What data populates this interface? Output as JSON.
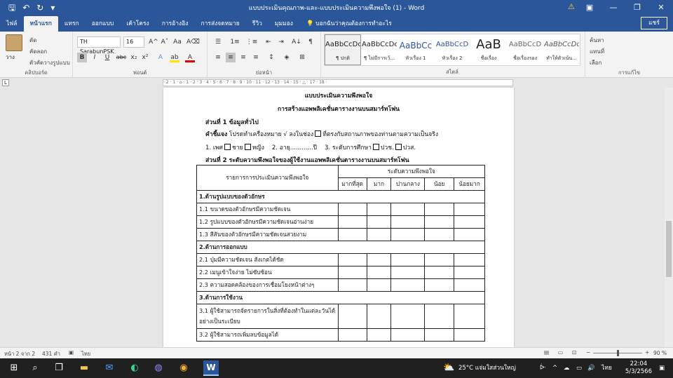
{
  "titlebar": {
    "title": "แบบประเมินคุณภาพ-และ-แบบประเมินความพึงพอใจ (1) - Word",
    "save_glyph": "🖫",
    "undo_glyph": "↶",
    "redo_glyph": "↻",
    "customize_glyph": "▾",
    "warning_glyph": "⚠",
    "ribbon_options_glyph": "▣",
    "minimize_glyph": "—",
    "restore_glyph": "❐",
    "close_glyph": "✕"
  },
  "tabs": [
    "ไฟล์",
    "หน้าแรก",
    "แทรก",
    "ออกแบบ",
    "เค้าโครง",
    "การอ้างอิง",
    "การส่งจดหมาย",
    "รีวิว",
    "มุมมอง"
  ],
  "tell_me": "💡 บอกฉันว่าคุณต้องการทำอะไร",
  "user_label": "แชร์",
  "ribbon": {
    "clipboard": {
      "paste": "วาง",
      "cut": "ตัด",
      "copy": "คัดลอก",
      "format_painter": "ตัวคัดวางรูปแบบ",
      "label": "คลิปบอร์ด"
    },
    "font": {
      "name": "TH SarabunPSK",
      "size": "16",
      "bold": "B",
      "italic": "I",
      "underline": "U",
      "strike": "abc",
      "subscript": "x₂",
      "superscript": "x²",
      "grow": "A^",
      "shrink": "Aˇ",
      "case": "Aa",
      "clear": "A⌫",
      "effects": "A",
      "highlight": "ab",
      "color": "A",
      "label": "ฟอนต์"
    },
    "paragraph": {
      "label": "ย่อหน้า",
      "bullets": "☰",
      "numbering": "1≡",
      "multilevel": "⋮≡",
      "decrease": "⇤",
      "increase": "⇥",
      "sort": "A↓",
      "marks": "¶",
      "align_left": "≡",
      "center": "≡",
      "align_right": "≡",
      "justify": "≡",
      "spacing": "↕",
      "shading": "◈",
      "borders": "⊞"
    },
    "styles": {
      "items": [
        {
          "sample": "AaBbCcDc",
          "name": "¶ ปกติ"
        },
        {
          "sample": "AaBbCcDc",
          "name": "¶ ไม่มีการเว้..."
        },
        {
          "sample": "AaBbCc",
          "name": "หัวเรื่อง 1"
        },
        {
          "sample": "AaBbCcD",
          "name": "หัวเรื่อง 2"
        },
        {
          "sample": "AaB",
          "name": "ชื่อเรื่อง"
        },
        {
          "sample": "AaBbCcD",
          "name": "ชื่อเรื่องรอง"
        },
        {
          "sample": "AaBbCcDc",
          "name": "ทำให้ตัวเน้น..."
        }
      ],
      "label": "สไตล์"
    },
    "editing": {
      "find": "ค้นหา",
      "replace": "แทนที่",
      "select": "เลือก",
      "label": "การแก้ไข"
    }
  },
  "ruler_text": "· 2 · 1 · ⌂ · 1 · 2 · 3 · 4 · 5 · 6 · 7 · 8 · 9 · 10 · 11 · 12 · 13 · 14 · 15 · △ · 17 · 18 ·",
  "ruler_tab_glyph": "L",
  "document": {
    "title1": "แบบประเมินความพึงพอใจ",
    "title2": "การสร้างแอพพลิเคชั่นตารางงานบนสมาร์ทโฟน",
    "part1": "ส่วนที่ 1 ข้อมูลทั่วไป",
    "instruction_label": "คำชี้แจง",
    "instruction_text": "โปรดทำเครื่องหมาย √ ลงในช่อง",
    "instruction_tail": "ที่ตรงกับสถานภาพของท่านตามความเป็นจริง",
    "q1": "1. เพศ",
    "q1_opt1": "ชาย",
    "q1_opt2": "หญิง",
    "q2": "2. อายุ............ปี",
    "q3": "3. ระดับการศึกษา",
    "q3_opt1": "ปวช.",
    "q3_opt2": "ปวส.",
    "part2": "ส่วนที่ 2 ระดับความพึงพอใจของผู้ใช้งานแอพพลิเคชั่นตารางงานบนสมาร์ทโฟน",
    "table": {
      "item_header": "รายการการประเมินความพึงพอใจ",
      "level_header": "ระดับความพึงพอใจ",
      "levels": [
        "มากที่สุด",
        "มาก",
        "ปานกลาง",
        "น้อย",
        "น้อยมาก"
      ],
      "rows": [
        {
          "text": "1.ด้านรูปแบบของตัวอักษร",
          "section": true
        },
        {
          "text": "1.1 ขนาดของตัวอักษรมีความชัดเจน",
          "section": false
        },
        {
          "text": "1.2 รูปแบบของตัวอักษรมีความชัดเจนอ่านง่าย",
          "section": false
        },
        {
          "text": "1.3 สีสันของตัวอักษรมีความชัดเจนสวยงาม",
          "section": false
        },
        {
          "text": "2.ด้านการออกแบบ",
          "section": true
        },
        {
          "text": "2.1 ปุ่มมีความชัดเจน สังเกตได้ชัด",
          "section": false
        },
        {
          "text": "2.2 เมนูเข้าใจง่าย ไม่ซับซ้อน",
          "section": false
        },
        {
          "text": "2.3 ความสอดคล้องของการเชื่อมโยงหน้าต่างๆ",
          "section": false
        },
        {
          "text": "3.ด้านการใช้งาน",
          "section": true
        },
        {
          "text": "3.1 ผู้ใช้สามารถจัดรายการในสิ่งที่ต้องทำในแต่ละวันได้อย่างเป็นระเบียบ",
          "section": false,
          "wrap": true
        },
        {
          "text": "3.2 ผู้ใช้สามารถเพิ่มลบข้อมูลได้",
          "section": false
        }
      ]
    }
  },
  "status": {
    "page": "หน้า 2 จาก 2",
    "words": "431 คำ",
    "proofing_glyph": "▣",
    "language": "ไทย",
    "view_read_glyph": "▤",
    "view_print_glyph": "▭",
    "view_web_glyph": "⊡",
    "zoom_out_glyph": "−",
    "zoom_in_glyph": "+",
    "zoom": "90 %",
    "zoom_fraction": 0.5
  },
  "taskbar": {
    "start_glyph": "⊞",
    "search_glyph": "⌕",
    "taskview_glyph": "❐",
    "explorer_glyph": "▬",
    "mail_glyph": "✉",
    "edge_glyph": "◐",
    "teams_glyph": "◍",
    "chrome_glyph": "◉",
    "word_glyph": "W",
    "weather_glyph": "⛅",
    "weather": "25°C แจ่มใสส่วนใหญ่",
    "tray_people_glyph": "ᐕ",
    "tray_chevron_glyph": "^",
    "tray_cloud_glyph": "☁",
    "tray_network_glyph": "▭",
    "tray_speaker_glyph": "🔊",
    "tray_lang": "ไทย",
    "time": "22:04",
    "date": "5/3/2566",
    "notification_glyph": "▣"
  }
}
